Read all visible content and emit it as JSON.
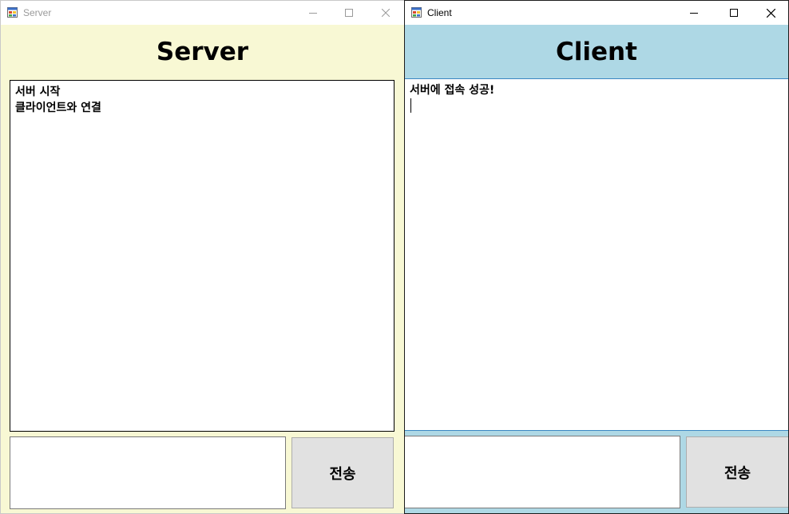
{
  "server_window": {
    "title": "Server",
    "heading": "Server",
    "log_lines": [
      "서버 시작",
      "클라이언트와 연결"
    ],
    "message_input": {
      "value": "",
      "placeholder": ""
    },
    "send_button_label": "전송",
    "background_color": "#f8f8d4",
    "title_color": "#9a9a9a",
    "window_icon": "app-icon"
  },
  "client_window": {
    "title": "Client",
    "heading": "Client",
    "log_lines": [
      "서버에 접속 성공!"
    ],
    "message_input": {
      "value": "",
      "placeholder": ""
    },
    "send_button_label": "전송",
    "background_color": "#aed8e5",
    "title_color": "#000000",
    "window_icon": "app-icon"
  },
  "caption_buttons": [
    "minimize-icon",
    "maximize-icon",
    "close-icon"
  ]
}
